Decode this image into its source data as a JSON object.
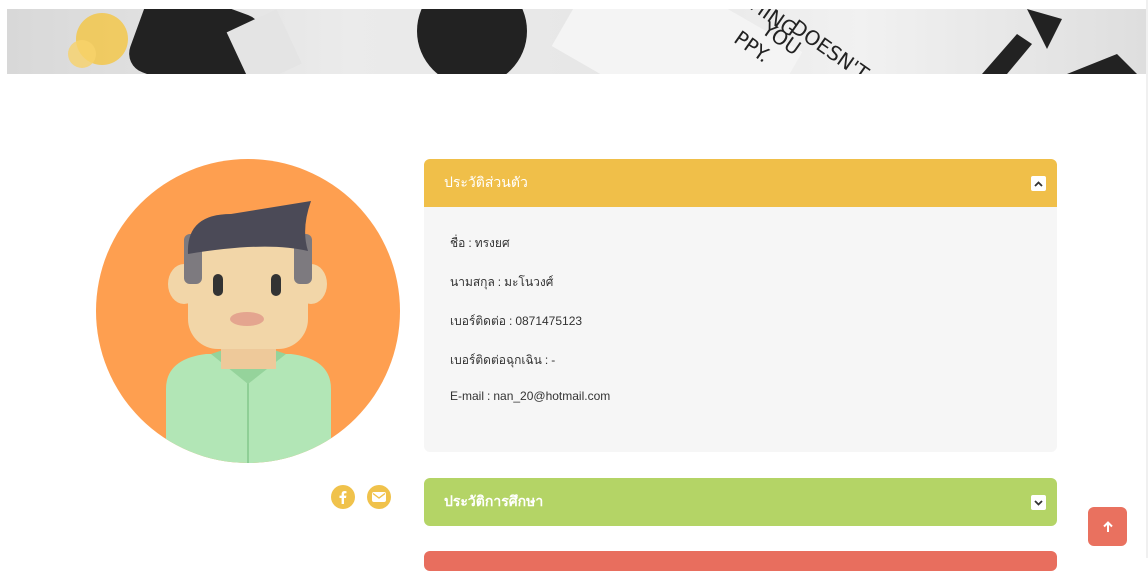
{
  "profile": {
    "sections": [
      {
        "title": "ประวัติส่วนตัว",
        "color": "#f0bf49",
        "expanded": true,
        "toggle_icon": "chevron-up-icon",
        "fields": [
          {
            "label": "ชื่อ",
            "value": "ทรงยศ"
          },
          {
            "label": "นามสกุล",
            "value": "มะโนวงศ์"
          },
          {
            "label": "เบอร์ติดต่อ",
            "value": "0871475123"
          },
          {
            "label": "เบอร์ติดต่อฉุกเฉิน",
            "value": "-"
          },
          {
            "label": "E-mail",
            "value": "nan_20@hotmail.com"
          }
        ]
      },
      {
        "title": "ประวัติการศึกษา",
        "color": "#b4d466",
        "expanded": false,
        "toggle_icon": "chevron-down-icon"
      },
      {
        "title": "",
        "color": "#e86e5e",
        "expanded": false
      }
    ],
    "social": [
      {
        "icon": "facebook-icon",
        "color": "#f0c24b"
      },
      {
        "icon": "mail-icon",
        "color": "#f0c24b"
      }
    ],
    "separator": ":"
  },
  "banner": {
    "image_text": [
      "THING",
      "DOESN'T",
      "YOU",
      "PPY."
    ]
  },
  "back_to_top": {
    "icon": "arrow-up-icon",
    "color": "#e9715f"
  }
}
